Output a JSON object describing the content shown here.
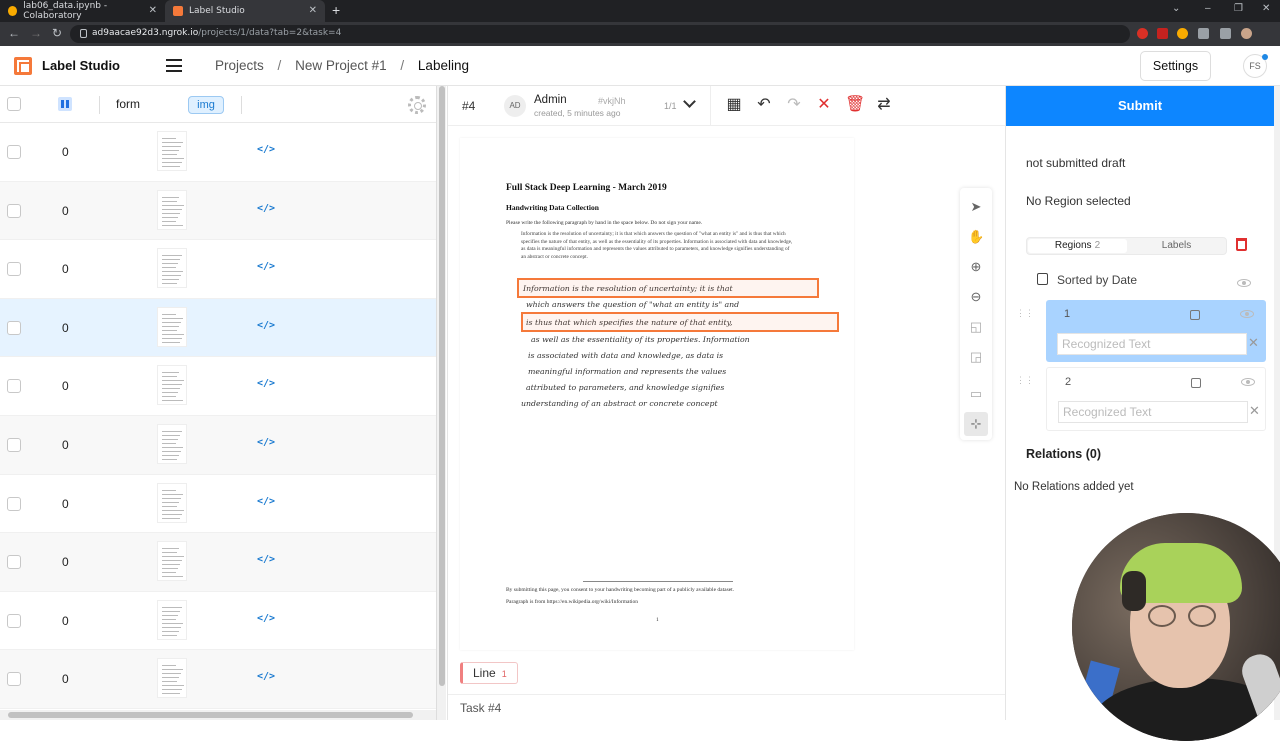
{
  "browser": {
    "tabs": [
      {
        "title": "lab06_data.ipynb - Colaboratory",
        "icon": "colab-icon",
        "active": false
      },
      {
        "title": "Label Studio",
        "icon": "label-studio-icon",
        "active": true
      }
    ],
    "url_host": "ad9aacae92d3.ngrok.io",
    "url_path": "/projects/1/data?tab=2&task=4"
  },
  "header": {
    "app_name": "Label Studio",
    "breadcrumbs": [
      "Projects",
      "New Project #1",
      "Labeling"
    ],
    "settings_label": "Settings",
    "avatar_initials": "FS"
  },
  "table": {
    "columns": {
      "form": "form",
      "img": "img"
    },
    "rows": [
      {
        "count": "0",
        "selected": false
      },
      {
        "count": "0",
        "selected": false
      },
      {
        "count": "0",
        "selected": false
      },
      {
        "count": "0",
        "selected": true
      },
      {
        "count": "0",
        "selected": false
      },
      {
        "count": "0",
        "selected": false
      },
      {
        "count": "0",
        "selected": false
      },
      {
        "count": "0",
        "selected": false
      },
      {
        "count": "0",
        "selected": false
      },
      {
        "count": "0",
        "selected": false
      }
    ],
    "code_label": "</>"
  },
  "task": {
    "id_label": "#4",
    "annotator_initials": "AD",
    "annotator": "Admin",
    "annotation_id": "#vkjNh",
    "created": "created, 5 minutes ago",
    "pager": "1/1",
    "footer": "Task #4"
  },
  "document": {
    "title": "Full Stack Deep Learning - March 2019",
    "subtitle": "Handwriting Data Collection",
    "instructions": "Please write the following paragraph by hand in the space below. Do not sign your name.",
    "paragraph": "Information is the resolution of uncertainty; it is that which answers the question of \"what an entity is\" and is thus that which specifies the nature of that entity, as well as the essentiality of its properties. Information is associated with data and knowledge, as data is meaningful information and represents the values attributed to parameters, and knowledge signifies understanding of an abstract or concrete concept.",
    "handwriting": [
      "Information is the resolution of uncertainty; it is that",
      "which answers the question of \"what an entity is\" and",
      "is thus that which specifies the nature of that entity,",
      "as well as the essentiality of its properties. Information",
      "is associated with data and knowledge, as data is",
      "meaningful information and represents the values",
      "attributed to parameters, and knowledge signifies",
      "understanding of an abstract or concrete concept"
    ],
    "footer1": "By submitting this page, you consent to your handwriting becoming part of a publicly available dataset.",
    "footer2": "Paragraph is from https://en.wikipedia.org/wiki/Information",
    "page_number": "1"
  },
  "label_chip": {
    "label": "Line",
    "count": "1"
  },
  "right_panel": {
    "submit_label": "Submit",
    "status": "not submitted draft",
    "selection": "No Region selected",
    "tabs": {
      "regions_label": "Regions",
      "regions_count": "2",
      "labels_label": "Labels"
    },
    "sort_label": "Sorted by Date",
    "regions": [
      {
        "index": "1",
        "placeholder": "Recognized Text",
        "highlighted": true
      },
      {
        "index": "2",
        "placeholder": "Recognized Text",
        "highlighted": false
      }
    ],
    "relations_title": "Relations (0)",
    "relations_empty": "No Relations added yet"
  },
  "colors": {
    "accent": "#0d86ff",
    "bbox": "#f5793a",
    "selected_row": "#e6f3ff",
    "region_highlight": "#a9d3ff"
  }
}
